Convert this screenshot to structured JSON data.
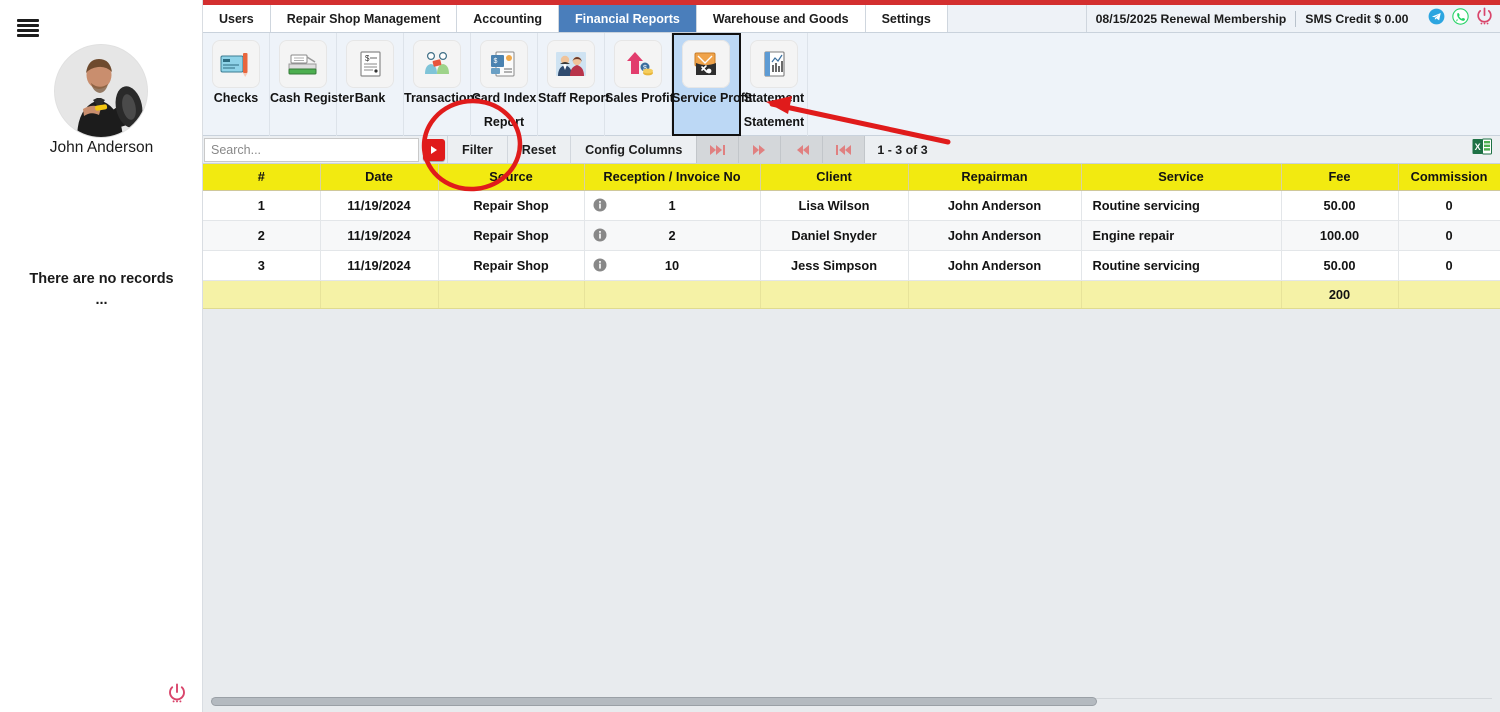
{
  "sidebar": {
    "menu_icon": "hamburger-icon",
    "user_name": "John Anderson",
    "avatar_alt": "user-avatar",
    "empty_text": "There are no records",
    "empty_ellipsis": "...",
    "power_icon": "power-icon"
  },
  "header": {
    "tabs": [
      {
        "label": "Users",
        "active": false
      },
      {
        "label": "Repair Shop Management",
        "active": false
      },
      {
        "label": "Accounting",
        "active": false
      },
      {
        "label": "Financial Reports",
        "active": true
      },
      {
        "label": "Warehouse and Goods",
        "active": false
      },
      {
        "label": "Settings",
        "active": false
      }
    ],
    "membership": "08/15/2025 Renewal Membership",
    "sms_credit": "SMS Credit $ 0.00",
    "icons": [
      "telegram-icon",
      "whatsapp-icon",
      "power-icon"
    ],
    "accent_red": "#d32f2f",
    "tab_active_bg": "#4a7ebb"
  },
  "ribbon": {
    "items": [
      {
        "label": "Checks",
        "label2": "",
        "icon": "checkbook-icon",
        "selected": false
      },
      {
        "label": "Cash Register",
        "label2": "",
        "icon": "cash-register-icon",
        "selected": false
      },
      {
        "label": "Bank",
        "label2": "",
        "icon": "bank-document-icon",
        "selected": false
      },
      {
        "label": "Transactions",
        "label2": "",
        "icon": "transactions-people-icon",
        "selected": false
      },
      {
        "label": "Card Index",
        "label2": "Report",
        "icon": "card-index-icon",
        "selected": false
      },
      {
        "label": "Staff Report",
        "label2": "",
        "icon": "staff-report-icon",
        "selected": false
      },
      {
        "label": "Sales Profit",
        "label2": "",
        "icon": "sales-profit-icon",
        "selected": false
      },
      {
        "label": "Service Profit",
        "label2": "",
        "icon": "service-profit-icon",
        "selected": true
      },
      {
        "label": "Statement",
        "label2": "Statement",
        "icon": "statement-icon",
        "selected": false
      }
    ]
  },
  "toolbar": {
    "search_placeholder": "Search...",
    "search_value": "",
    "dropdown_icon": "red-play-button",
    "filter_label": "Filter",
    "reset_label": "Reset",
    "config_columns_label": "Config Columns",
    "pagination": {
      "last_icon": "▶▶|",
      "next_icon": "▶▶",
      "prev_icon": "◀◀",
      "first_icon": "|◀◀",
      "range": "1 - 3 of 3"
    },
    "export_icon": "excel-export-icon"
  },
  "table": {
    "columns": [
      "#",
      "Date",
      "Source",
      "Reception / Invoice No",
      "Client",
      "Repairman",
      "Service",
      "Fee",
      "Commission"
    ],
    "rows": [
      {
        "num": "1",
        "date": "11/19/2024",
        "source": "Repair Shop",
        "info_icon": "info-icon",
        "invoice": "1",
        "client": "Lisa Wilson",
        "repairman": "John Anderson",
        "service": "Routine servicing",
        "fee": "50.00",
        "commission": "0"
      },
      {
        "num": "2",
        "date": "11/19/2024",
        "source": "Repair Shop",
        "info_icon": "info-icon",
        "invoice": "2",
        "client": "Daniel Snyder",
        "repairman": "John Anderson",
        "service": "Engine repair",
        "fee": "100.00",
        "commission": "0"
      },
      {
        "num": "3",
        "date": "11/19/2024",
        "source": "Repair Shop",
        "info_icon": "info-icon",
        "invoice": "10",
        "client": "Jess Simpson",
        "repairman": "John Anderson",
        "service": "Routine servicing",
        "fee": "50.00",
        "commission": "0"
      }
    ],
    "total": {
      "fee": "200",
      "commission": ""
    },
    "header_bg": "#f2ea10",
    "total_bg": "#f5f2a6"
  },
  "annotations": {
    "circle_target": "filter-button-circle",
    "arrow_target": "service-profit-arrow",
    "color": "#e01b1b"
  }
}
